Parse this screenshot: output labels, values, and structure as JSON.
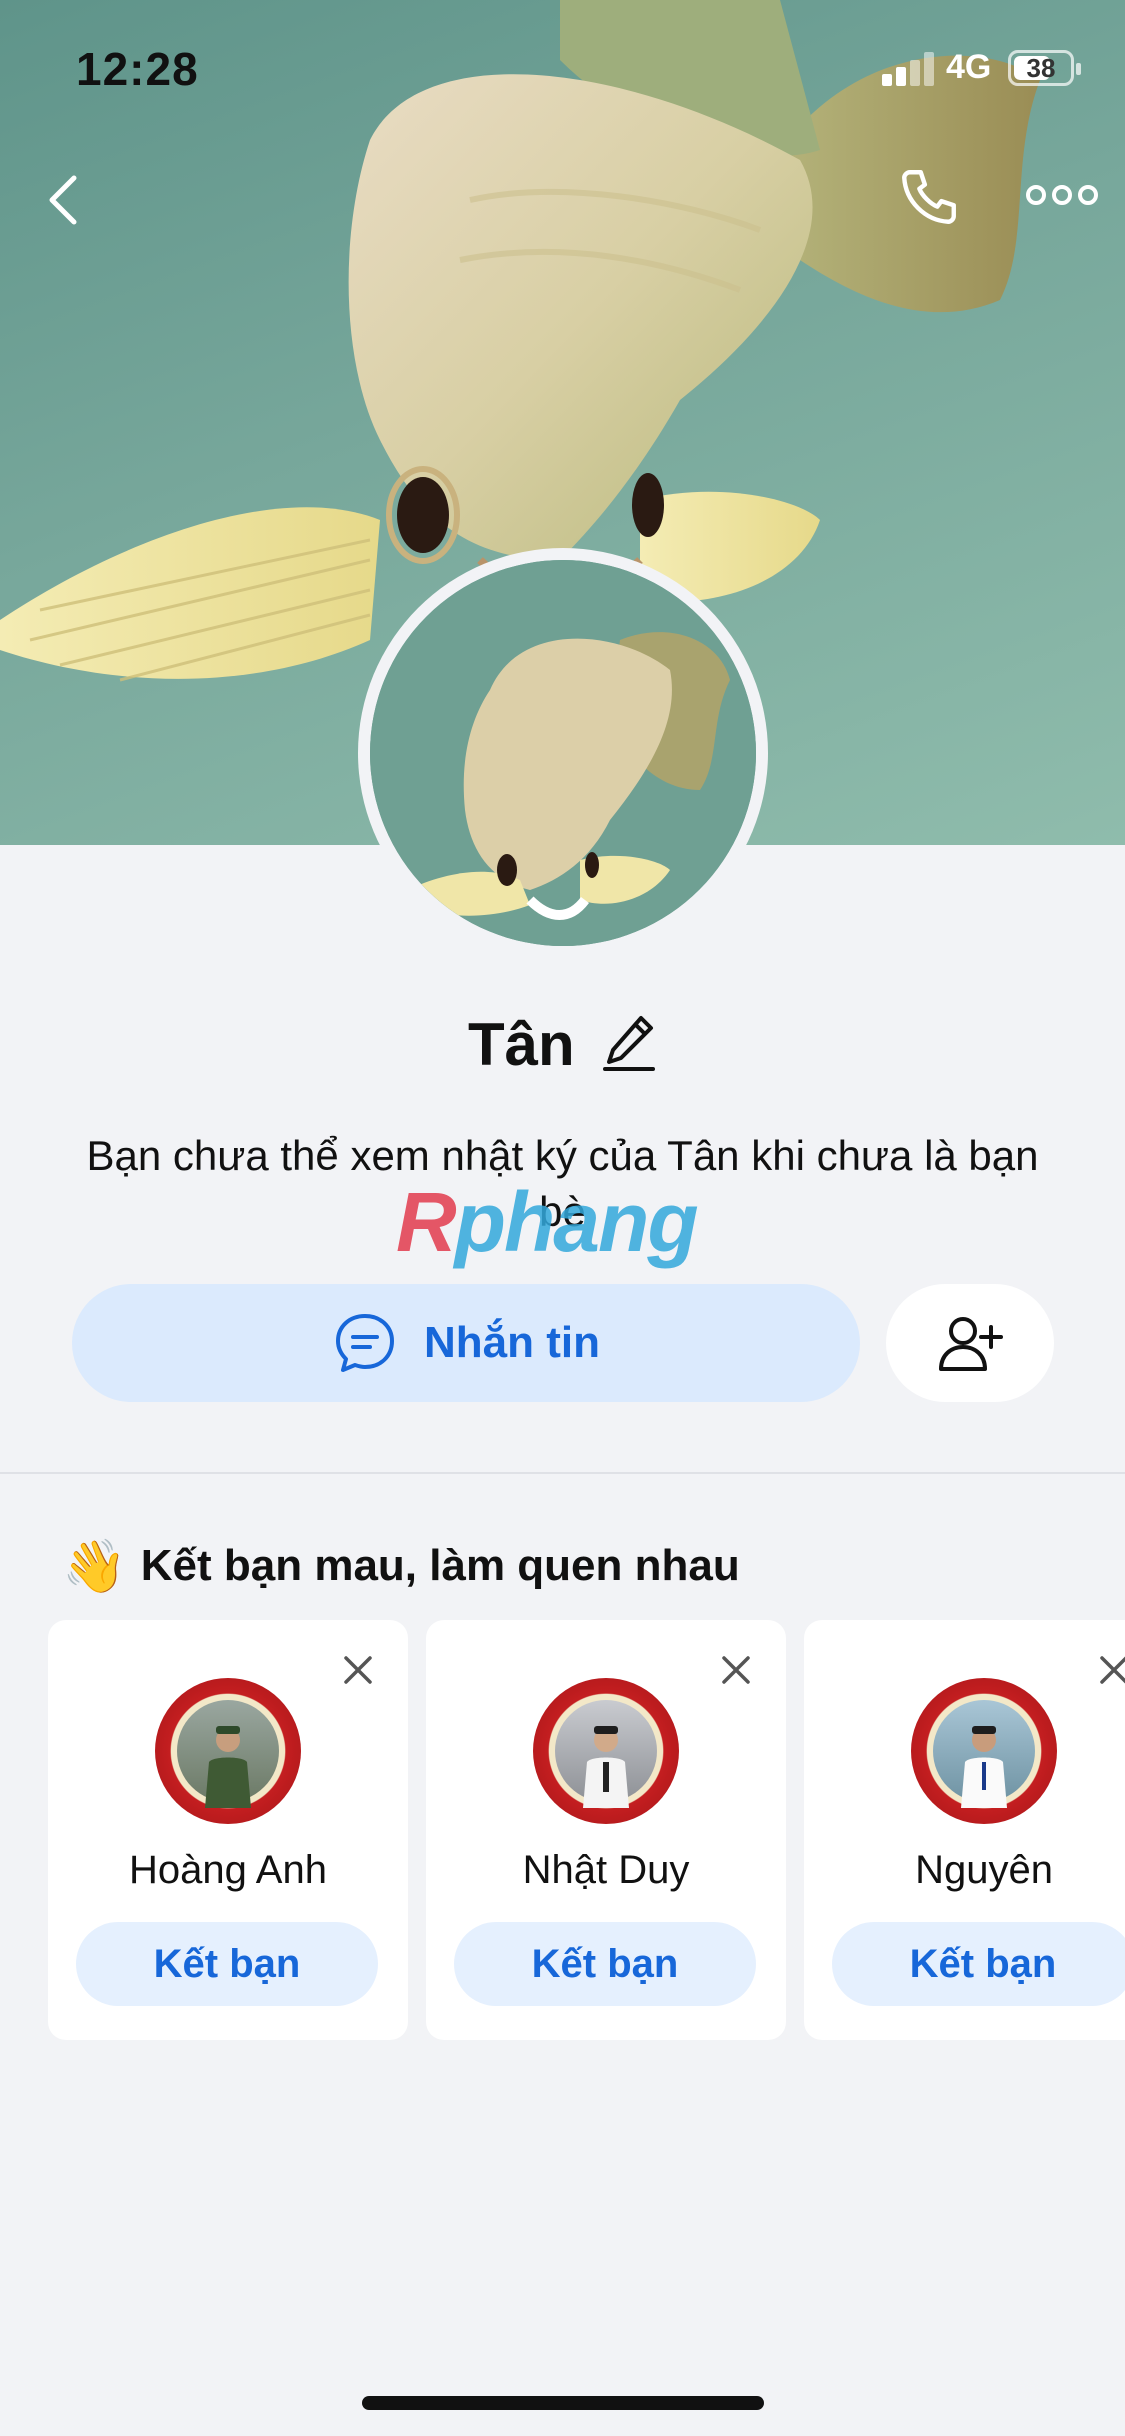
{
  "status_bar": {
    "time": "12:28",
    "network": "4G",
    "battery": "38"
  },
  "header": {
    "back_icon": "chevron-left-icon",
    "call_icon": "phone-icon",
    "more_icon": "more-dots-icon"
  },
  "profile": {
    "name": "Tân",
    "edit_icon": "pencil-icon",
    "notice": "Bạn chưa thể xem nhật ký của Tân khi chưa là bạn bè",
    "watermark": "Rphang"
  },
  "actions": {
    "message_label": "Nhắn tin",
    "message_icon": "chat-bubble-icon",
    "add_friend_icon": "add-user-icon"
  },
  "suggestions": {
    "title": "Kết bạn mau, làm quen nhau",
    "title_emoji": "👋",
    "items": [
      {
        "name": "Hoàng Anh",
        "button": "Kết bạn"
      },
      {
        "name": "Nhật Duy",
        "button": "Kết bạn"
      },
      {
        "name": "Nguyên",
        "button": "Kết bạn"
      }
    ]
  },
  "colors": {
    "accent": "#1767d9",
    "accent_soft": "#dbeafd",
    "background": "#f2f3f6"
  }
}
